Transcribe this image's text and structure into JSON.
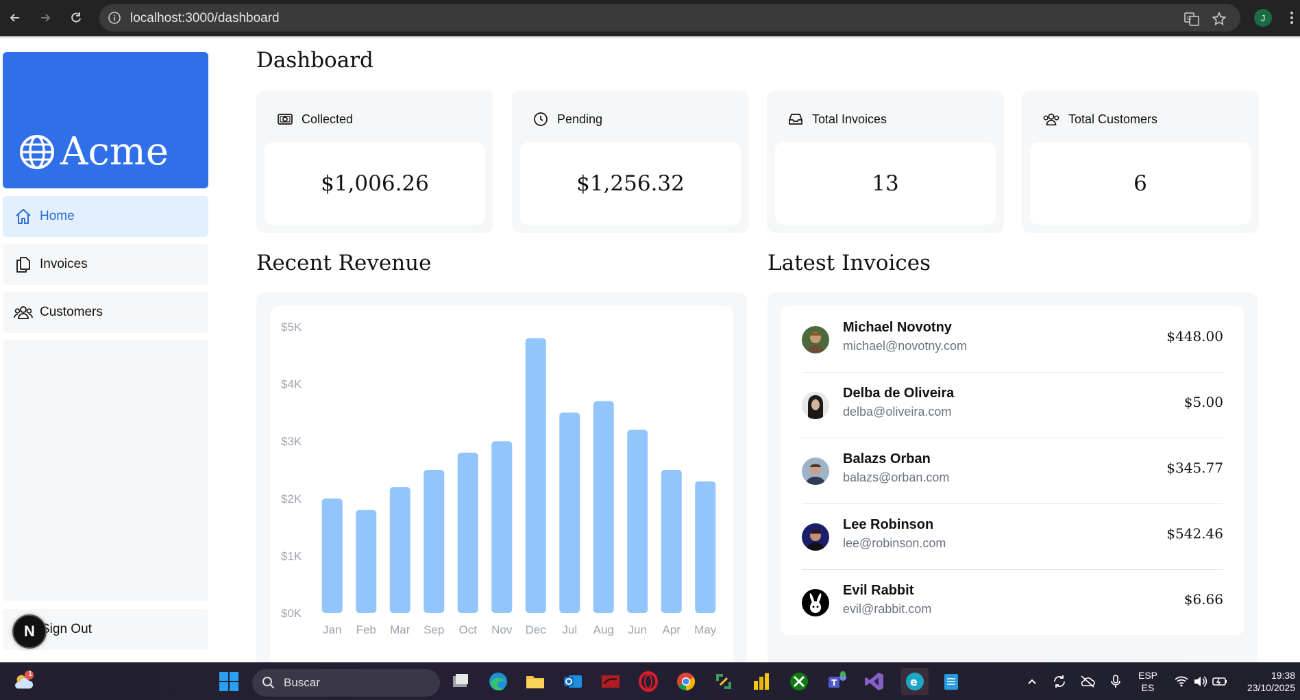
{
  "browser": {
    "url": "localhost:3000/dashboard",
    "profile_initial": "J"
  },
  "sidebar": {
    "logo_text": "Acme",
    "items": [
      {
        "label": "Home",
        "icon": "home-icon",
        "active": true
      },
      {
        "label": "Invoices",
        "icon": "document-icon",
        "active": false
      },
      {
        "label": "Customers",
        "icon": "users-icon",
        "active": false
      }
    ],
    "sign_out": "Sign Out",
    "dev_badge": "N"
  },
  "main": {
    "title": "Dashboard",
    "cards": [
      {
        "label": "Collected",
        "value": "$1,006.26",
        "icon": "banknote-icon"
      },
      {
        "label": "Pending",
        "value": "$1,256.32",
        "icon": "clock-icon"
      },
      {
        "label": "Total Invoices",
        "value": "13",
        "icon": "inbox-icon"
      },
      {
        "label": "Total Customers",
        "value": "6",
        "icon": "users-icon"
      }
    ],
    "revenue_title": "Recent Revenue",
    "invoices_title": "Latest Invoices"
  },
  "chart_data": {
    "type": "bar",
    "categories": [
      "Jan",
      "Feb",
      "Mar",
      "Sep",
      "Oct",
      "Nov",
      "Dec",
      "Jul",
      "Aug",
      "Jun",
      "Apr",
      "May"
    ],
    "values": [
      2000,
      1800,
      2200,
      2500,
      2800,
      3000,
      4800,
      3500,
      3700,
      3200,
      2500,
      2300
    ],
    "ylim": [
      0,
      5000
    ],
    "y_ticks": [
      "$0K",
      "$1K",
      "$2K",
      "$3K",
      "$4K",
      "$5K"
    ],
    "bar_color": "#93c5fd",
    "title": "",
    "xlabel": "",
    "ylabel": ""
  },
  "invoices": [
    {
      "name": "Michael Novotny",
      "email": "michael@novotny.com",
      "amount": "$448.00",
      "avatar": "avatar-michael"
    },
    {
      "name": "Delba de Oliveira",
      "email": "delba@oliveira.com",
      "amount": "$5.00",
      "avatar": "avatar-delba"
    },
    {
      "name": "Balazs Orban",
      "email": "balazs@orban.com",
      "amount": "$345.77",
      "avatar": "avatar-balazs"
    },
    {
      "name": "Lee Robinson",
      "email": "lee@robinson.com",
      "amount": "$542.46",
      "avatar": "avatar-lee"
    },
    {
      "name": "Evil Rabbit",
      "email": "evil@rabbit.com",
      "amount": "$6.66",
      "avatar": "avatar-rabbit"
    }
  ],
  "taskbar": {
    "search_label": "Buscar",
    "weather_badge": "1",
    "language": "ESP",
    "layout": "ES",
    "time": "19:38",
    "date": "23/10/2025"
  },
  "colors": {
    "brand": "#2f6fe8",
    "active_nav_bg": "#e1efff",
    "active_nav_text": "#2c6bd9",
    "panel_bg": "#f5f7f9"
  }
}
